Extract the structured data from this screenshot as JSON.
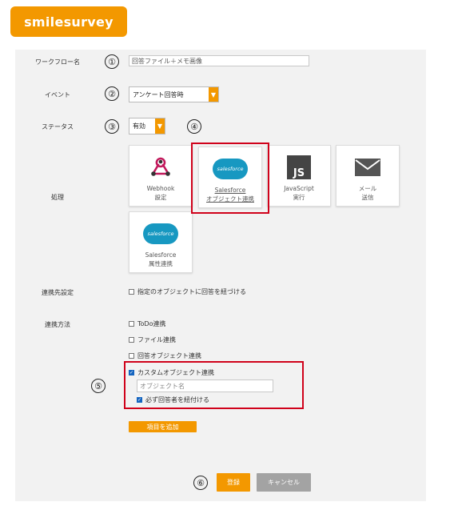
{
  "brand": {
    "logo_text": "smilesurvey",
    "accent": "#f39800",
    "highlight": "#d0021b"
  },
  "form": {
    "workflow_name": {
      "label": "ワークフロー名",
      "marker": "①",
      "value": "回答ファイル＋メモ画像"
    },
    "event": {
      "label": "イベント",
      "marker": "②",
      "value": "アンケート回答時"
    },
    "status": {
      "label": "ステータス",
      "marker": "③",
      "value": "有効"
    },
    "process": {
      "label": "処理",
      "marker": "④",
      "cards": [
        {
          "line1": "Webhook",
          "line2": "設定",
          "icon": "webhook-icon"
        },
        {
          "line1": "Salesforce",
          "line2": "オブジェクト連携",
          "icon": "salesforce-icon",
          "icon_text": "salesforce"
        },
        {
          "line1": "JavaScript",
          "line2": "実行",
          "icon": "javascript-icon",
          "icon_text": "JS"
        },
        {
          "line1": "メール",
          "line2": "送信",
          "icon": "mail-icon"
        },
        {
          "line1": "Salesforce",
          "line2": "属性連携",
          "icon": "salesforce-icon",
          "icon_text": "salesforce"
        }
      ]
    },
    "link_target": {
      "label": "連携先設定",
      "option": "指定のオブジェクトに回答を紐づける"
    },
    "link_method": {
      "label": "連携方法",
      "marker": "⑤",
      "options": [
        "ToDo連携",
        "ファイル連携",
        "回答オブジェクト連携",
        "カスタムオブジェクト連携"
      ],
      "object_name_placeholder": "オブジェクト名",
      "bind_respondent": "必ず回答者を紐付ける"
    },
    "add_item_button": "項目を追加"
  },
  "footer": {
    "marker": "⑥",
    "register_button": "登録",
    "cancel_button": "キャンセル"
  }
}
